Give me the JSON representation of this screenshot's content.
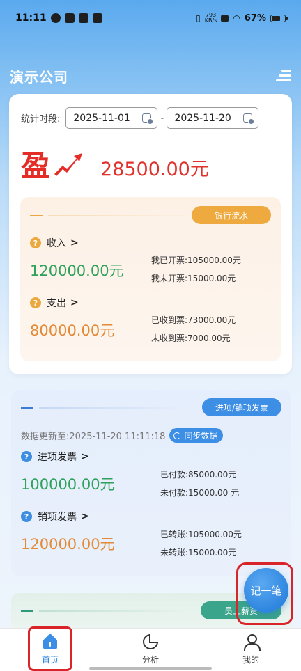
{
  "status_bar": {
    "time": "11:11",
    "net_speed_value": "793",
    "net_speed_unit": "KB/s",
    "battery": "67%"
  },
  "header": {
    "company": "演示公司"
  },
  "period": {
    "label": "统计时段:",
    "start": "2025-11-01",
    "end": "2025-11-20",
    "separator": "-"
  },
  "profit": {
    "label": "盈",
    "amount": "28500.00元",
    "color": "#e0322c"
  },
  "bank": {
    "tag": "银行流水",
    "income": {
      "title": "收入",
      "amount": "120000.00元",
      "invoiced": "我已开票:105000.00元",
      "not_invoiced": "我未开票:15000.00元"
    },
    "expense": {
      "title": "支出",
      "amount": "80000.00元",
      "received": "已收到票:73000.00元",
      "not_received": "未收到票:7000.00元"
    }
  },
  "invoices": {
    "tag": "进项/销项发票",
    "updated_at": "数据更新至:2025-11-20 11:11:18",
    "sync_label": "同步数据",
    "input": {
      "title": "进项发票",
      "amount": "100000.00元",
      "paid": "已付款:85000.00元",
      "unpaid": "未付款:15000.00 元"
    },
    "output": {
      "title": "销项发票",
      "amount": "120000.00元",
      "transferred": "已转账:105000.00元",
      "not_transferred": "未转账:15000.00元"
    }
  },
  "salary": {
    "tag": "员工薪资"
  },
  "fab": {
    "label": "记一笔"
  },
  "tabs": [
    {
      "label": "首页",
      "icon": "home-icon"
    },
    {
      "label": "分析",
      "icon": "pie-chart-icon"
    },
    {
      "label": "我的",
      "icon": "user-icon"
    }
  ],
  "colors": {
    "accent_blue": "#3d8ee5",
    "income_green": "#2ea15b",
    "expense_orange": "#e48935",
    "highlight_red": "#d9252a"
  }
}
